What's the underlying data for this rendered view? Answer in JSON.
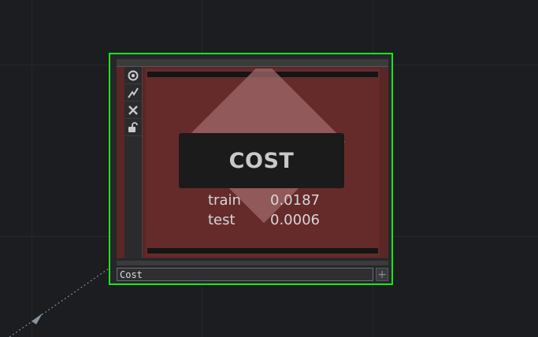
{
  "node": {
    "title": "COST",
    "metrics": [
      {
        "label": "train",
        "value": "0.0187"
      },
      {
        "label": "test",
        "value": "0.0006"
      }
    ],
    "name_value": "Cost",
    "add_button_label": "+"
  },
  "toolbar": {
    "icons": [
      "viewer-toggle-icon",
      "bypass-icon",
      "close-icon",
      "lock-icon"
    ]
  },
  "colors": {
    "selection_border": "#19e619",
    "node_body": "#652b2b",
    "canvas": "#1c1d20"
  }
}
